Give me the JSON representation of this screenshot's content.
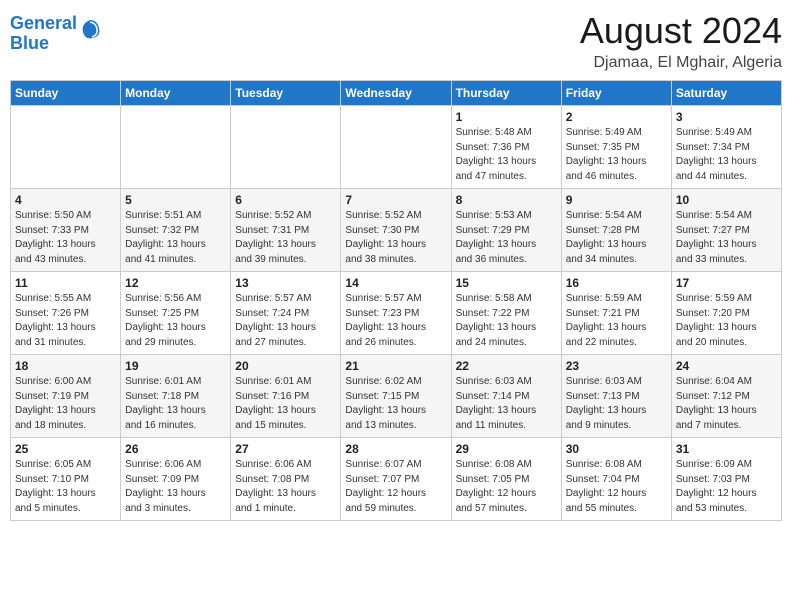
{
  "logo": {
    "line1": "General",
    "line2": "Blue"
  },
  "title": "August 2024",
  "subtitle": "Djamaa, El Mghair, Algeria",
  "headers": [
    "Sunday",
    "Monday",
    "Tuesday",
    "Wednesday",
    "Thursday",
    "Friday",
    "Saturday"
  ],
  "weeks": [
    [
      {
        "day": "",
        "info": ""
      },
      {
        "day": "",
        "info": ""
      },
      {
        "day": "",
        "info": ""
      },
      {
        "day": "",
        "info": ""
      },
      {
        "day": "1",
        "info": "Sunrise: 5:48 AM\nSunset: 7:36 PM\nDaylight: 13 hours\nand 47 minutes."
      },
      {
        "day": "2",
        "info": "Sunrise: 5:49 AM\nSunset: 7:35 PM\nDaylight: 13 hours\nand 46 minutes."
      },
      {
        "day": "3",
        "info": "Sunrise: 5:49 AM\nSunset: 7:34 PM\nDaylight: 13 hours\nand 44 minutes."
      }
    ],
    [
      {
        "day": "4",
        "info": "Sunrise: 5:50 AM\nSunset: 7:33 PM\nDaylight: 13 hours\nand 43 minutes."
      },
      {
        "day": "5",
        "info": "Sunrise: 5:51 AM\nSunset: 7:32 PM\nDaylight: 13 hours\nand 41 minutes."
      },
      {
        "day": "6",
        "info": "Sunrise: 5:52 AM\nSunset: 7:31 PM\nDaylight: 13 hours\nand 39 minutes."
      },
      {
        "day": "7",
        "info": "Sunrise: 5:52 AM\nSunset: 7:30 PM\nDaylight: 13 hours\nand 38 minutes."
      },
      {
        "day": "8",
        "info": "Sunrise: 5:53 AM\nSunset: 7:29 PM\nDaylight: 13 hours\nand 36 minutes."
      },
      {
        "day": "9",
        "info": "Sunrise: 5:54 AM\nSunset: 7:28 PM\nDaylight: 13 hours\nand 34 minutes."
      },
      {
        "day": "10",
        "info": "Sunrise: 5:54 AM\nSunset: 7:27 PM\nDaylight: 13 hours\nand 33 minutes."
      }
    ],
    [
      {
        "day": "11",
        "info": "Sunrise: 5:55 AM\nSunset: 7:26 PM\nDaylight: 13 hours\nand 31 minutes."
      },
      {
        "day": "12",
        "info": "Sunrise: 5:56 AM\nSunset: 7:25 PM\nDaylight: 13 hours\nand 29 minutes."
      },
      {
        "day": "13",
        "info": "Sunrise: 5:57 AM\nSunset: 7:24 PM\nDaylight: 13 hours\nand 27 minutes."
      },
      {
        "day": "14",
        "info": "Sunrise: 5:57 AM\nSunset: 7:23 PM\nDaylight: 13 hours\nand 26 minutes."
      },
      {
        "day": "15",
        "info": "Sunrise: 5:58 AM\nSunset: 7:22 PM\nDaylight: 13 hours\nand 24 minutes."
      },
      {
        "day": "16",
        "info": "Sunrise: 5:59 AM\nSunset: 7:21 PM\nDaylight: 13 hours\nand 22 minutes."
      },
      {
        "day": "17",
        "info": "Sunrise: 5:59 AM\nSunset: 7:20 PM\nDaylight: 13 hours\nand 20 minutes."
      }
    ],
    [
      {
        "day": "18",
        "info": "Sunrise: 6:00 AM\nSunset: 7:19 PM\nDaylight: 13 hours\nand 18 minutes."
      },
      {
        "day": "19",
        "info": "Sunrise: 6:01 AM\nSunset: 7:18 PM\nDaylight: 13 hours\nand 16 minutes."
      },
      {
        "day": "20",
        "info": "Sunrise: 6:01 AM\nSunset: 7:16 PM\nDaylight: 13 hours\nand 15 minutes."
      },
      {
        "day": "21",
        "info": "Sunrise: 6:02 AM\nSunset: 7:15 PM\nDaylight: 13 hours\nand 13 minutes."
      },
      {
        "day": "22",
        "info": "Sunrise: 6:03 AM\nSunset: 7:14 PM\nDaylight: 13 hours\nand 11 minutes."
      },
      {
        "day": "23",
        "info": "Sunrise: 6:03 AM\nSunset: 7:13 PM\nDaylight: 13 hours\nand 9 minutes."
      },
      {
        "day": "24",
        "info": "Sunrise: 6:04 AM\nSunset: 7:12 PM\nDaylight: 13 hours\nand 7 minutes."
      }
    ],
    [
      {
        "day": "25",
        "info": "Sunrise: 6:05 AM\nSunset: 7:10 PM\nDaylight: 13 hours\nand 5 minutes."
      },
      {
        "day": "26",
        "info": "Sunrise: 6:06 AM\nSunset: 7:09 PM\nDaylight: 13 hours\nand 3 minutes."
      },
      {
        "day": "27",
        "info": "Sunrise: 6:06 AM\nSunset: 7:08 PM\nDaylight: 13 hours\nand 1 minute."
      },
      {
        "day": "28",
        "info": "Sunrise: 6:07 AM\nSunset: 7:07 PM\nDaylight: 12 hours\nand 59 minutes."
      },
      {
        "day": "29",
        "info": "Sunrise: 6:08 AM\nSunset: 7:05 PM\nDaylight: 12 hours\nand 57 minutes."
      },
      {
        "day": "30",
        "info": "Sunrise: 6:08 AM\nSunset: 7:04 PM\nDaylight: 12 hours\nand 55 minutes."
      },
      {
        "day": "31",
        "info": "Sunrise: 6:09 AM\nSunset: 7:03 PM\nDaylight: 12 hours\nand 53 minutes."
      }
    ]
  ]
}
